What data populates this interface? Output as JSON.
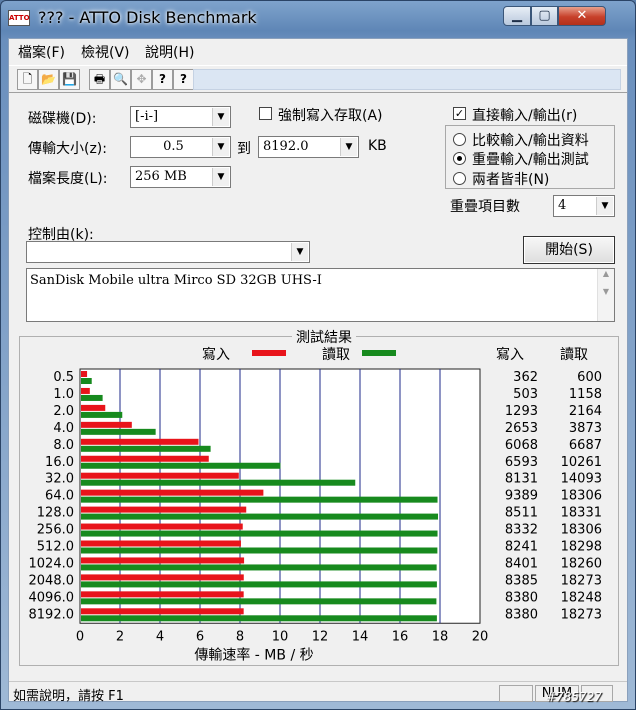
{
  "window": {
    "title": "??? - ATTO Disk Benchmark",
    "icon_text": "ATTO",
    "minimize": "▁",
    "maximize": "▢",
    "close": "✕"
  },
  "menu": [
    "檔案(F)",
    "檢視(V)",
    "說明(H)"
  ],
  "toolbar": {
    "buttons": [
      "new-icon",
      "open-icon",
      "save-icon",
      "print-icon",
      "print-preview-icon",
      "move-icon",
      "help-icon",
      "context-help-icon"
    ],
    "glyphs": [
      "🗋",
      "📂",
      "💾",
      "🖶",
      "🔍",
      "✥",
      "?",
      "?"
    ]
  },
  "settings": {
    "drive_label": "磁碟機(D):",
    "drive_value": "[-i-]",
    "force_write_label": "強制寫入存取(A)",
    "force_write_checked": false,
    "transfer_size_label": "傳輸大小(z):",
    "transfer_from": "0.5",
    "to_label": "到",
    "transfer_to": "8192.0",
    "unit": "KB",
    "file_length_label": "檔案長度(L):",
    "file_length_value": "256 MB",
    "direct_io_label": "直接輸入/輸出(r)",
    "direct_io_checked": true,
    "radio_options": [
      "比較輸入/輸出資料",
      "重疊輸入/輸出測試",
      "兩者皆非(N)"
    ],
    "radio_selected": 1,
    "queue_depth_label": "重疊項目數",
    "queue_depth_value": "4",
    "controlled_by_label": "控制由(k):",
    "controlled_by_value": "",
    "start_button": "開始(S)",
    "description": "SanDisk Mobile ultra Mirco SD 32GB UHS-I"
  },
  "results": {
    "legend_title": "測試結果",
    "write_legend": "寫入",
    "read_legend": "讀取",
    "write_col": "寫入",
    "read_col": "讀取",
    "write_color": "#e8141b",
    "read_color": "#178a1e"
  },
  "chart_data": {
    "type": "bar",
    "orientation": "horizontal",
    "categories": [
      "0.5",
      "1.0",
      "2.0",
      "4.0",
      "8.0",
      "16.0",
      "32.0",
      "64.0",
      "128.0",
      "256.0",
      "512.0",
      "1024.0",
      "2048.0",
      "4096.0",
      "8192.0"
    ],
    "series": [
      {
        "name": "寫入",
        "values": [
          362,
          503,
          1293,
          2653,
          6068,
          6593,
          8131,
          9389,
          8511,
          8332,
          8241,
          8401,
          8385,
          8380,
          8380
        ]
      },
      {
        "name": "讀取",
        "values": [
          600,
          1158,
          2164,
          3873,
          6687,
          10261,
          14093,
          18306,
          18331,
          18306,
          18298,
          18260,
          18273,
          18248,
          18273
        ]
      }
    ],
    "xlabel": "傳輸速率 - MB / 秒",
    "xticks": [
      0,
      2,
      4,
      6,
      8,
      10,
      12,
      14,
      16,
      18,
      20
    ],
    "xlim": [
      0,
      20
    ],
    "unit_note": "values in KB/s; axis in MB/s"
  },
  "status": {
    "help_text": "如需說明，請按 F1",
    "num": "NUM"
  },
  "watermark": "#785727"
}
